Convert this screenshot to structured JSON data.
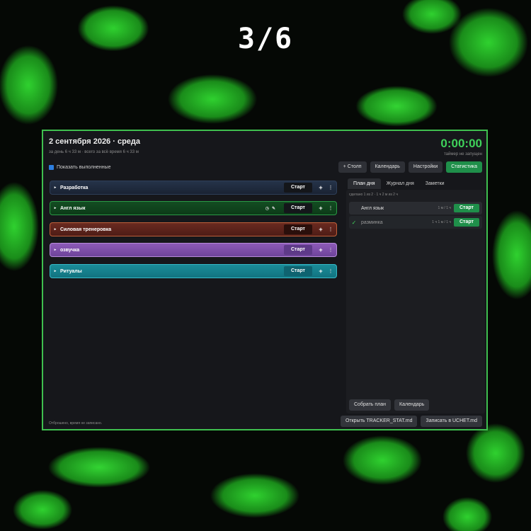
{
  "counter": "3/6",
  "header": {
    "date": "2 сентября 2026 · среда",
    "subtitle": "за день 6 ч 33 м · всего за всё время 6 ч 33 м",
    "timer": "0:00:00",
    "timer_status": "таймер не запущен"
  },
  "show_done_label": "Показать выполненные",
  "toolbar": {
    "add_column": "+ Столп",
    "calendar": "Календарь",
    "settings": "Настройки",
    "statistics": "Статистика"
  },
  "projects": [
    {
      "name": "Разработка",
      "start": "Старт",
      "color": "#253349"
    },
    {
      "name": "Англ язык",
      "start": "Старт",
      "color": "#134d22"
    },
    {
      "name": "Силовая тренеровка",
      "start": "Старт",
      "color": "#6a2a20"
    },
    {
      "name": "озвучка",
      "start": "Старт",
      "color": "#8d5ab8"
    },
    {
      "name": "Ритуалы",
      "start": "Старт",
      "color": "#1a8c99"
    }
  ],
  "icons": {
    "clock": "clock-icon",
    "edit": "pencil-icon",
    "plus": "plus-icon",
    "more": "more-vertical-icon",
    "expand": "triangle-right-icon",
    "done": "checkmark-icon"
  },
  "tabs": [
    "План дня",
    "Журнал дня",
    "Заметки"
  ],
  "plan": {
    "summary": "сделано 1 из 2 · 1 ч 2 м из 2 ч",
    "tasks": [
      {
        "name": "Англ язык",
        "value": "1 м / 1 ч",
        "start": "Старт",
        "done": false
      },
      {
        "name": "разминка",
        "value": "1 ч 1 м / 1 ч",
        "start": "Старт",
        "done": true
      }
    ],
    "collect_plan": "Собрать план",
    "calendar": "Календарь"
  },
  "footer": {
    "status": "Отброшено, время не записано.",
    "open_stat": "Открыть TRACKER_STAT.md",
    "write_uchet": "Записать в UCHET.md"
  },
  "accent_color": "#3fbf4f"
}
